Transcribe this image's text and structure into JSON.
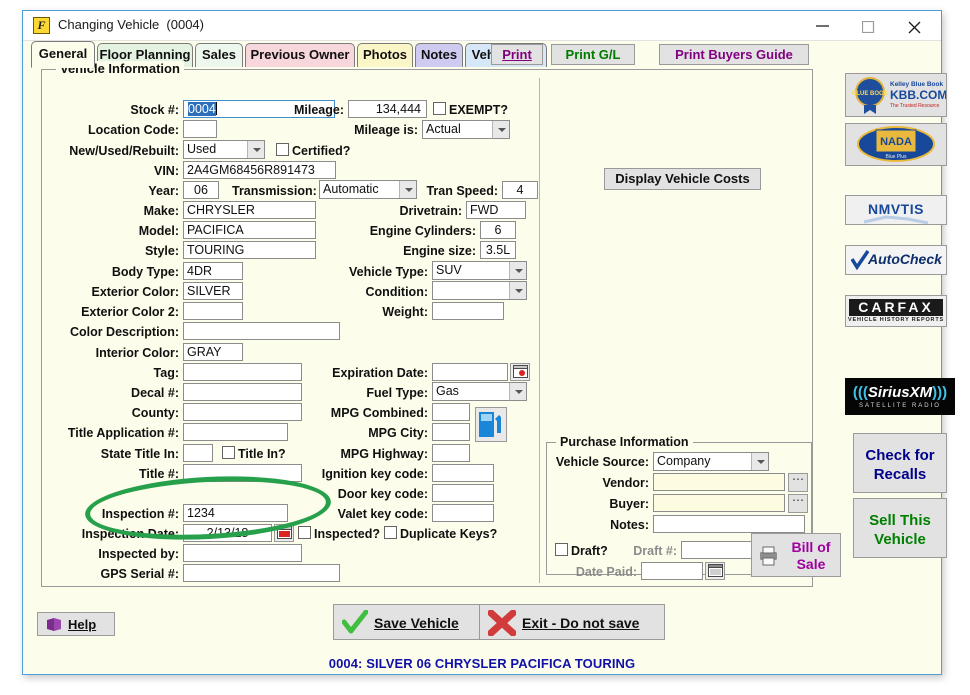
{
  "window": {
    "title": "Changing Vehicle  (0004)",
    "icon": "app-icon",
    "minimize": "minimize-icon",
    "maximize": "maximize-icon",
    "close": "close-icon"
  },
  "tabs": [
    {
      "label": "General",
      "active": true,
      "color": "#fdfdec"
    },
    {
      "label": "Floor Planning",
      "active": false,
      "color": "#e4f2e2"
    },
    {
      "label": "Sales",
      "active": false,
      "color": "#eef7ee"
    },
    {
      "label": "Previous Owner",
      "active": false,
      "color": "#f8d7dc"
    },
    {
      "label": "Photos",
      "active": false,
      "color": "#fbf6c8"
    },
    {
      "label": "Notes",
      "active": false,
      "color": "#cfcbf0"
    },
    {
      "label": "Vehicle Bill",
      "active": false,
      "color": "#d6e7f7"
    }
  ],
  "toolbar": {
    "print": "Print",
    "print_gl": "Print G/L",
    "print_buyers_guide": "Print Buyers Guide",
    "print_gl_color": "#007a00",
    "buyers_guide_color": "#800080",
    "print_color": "#800080"
  },
  "panel": {
    "legend": "Vehicle Information"
  },
  "fields": {
    "stock_no": {
      "label": "Stock #:",
      "value": "0004"
    },
    "mileage": {
      "label": "Mileage:",
      "value": "134,444"
    },
    "exempt": {
      "label": "EXEMPT?",
      "checked": false
    },
    "location_code": {
      "label": "Location Code:",
      "value": ""
    },
    "mileage_is": {
      "label": "Mileage is:",
      "value": "Actual"
    },
    "new_used": {
      "label": "New/Used/Rebuilt:",
      "value": "Used"
    },
    "certified": {
      "label": "Certified?",
      "checked": false
    },
    "vin": {
      "label": "VIN:",
      "value": "2A4GM68456R891473"
    },
    "year": {
      "label": "Year:",
      "value": "06"
    },
    "transmission": {
      "label": "Transmission:",
      "value": "Automatic"
    },
    "tran_speed": {
      "label": "Tran Speed:",
      "value": "4"
    },
    "make": {
      "label": "Make:",
      "value": "CHRYSLER"
    },
    "drivetrain": {
      "label": "Drivetrain:",
      "value": "FWD"
    },
    "model": {
      "label": "Model:",
      "value": "PACIFICA"
    },
    "engine_cylinders": {
      "label": "Engine Cylinders:",
      "value": "6"
    },
    "style": {
      "label": "Style:",
      "value": "TOURING"
    },
    "engine_size": {
      "label": "Engine size:",
      "value": "3.5L"
    },
    "body_type": {
      "label": "Body Type:",
      "value": "4DR"
    },
    "vehicle_type": {
      "label": "Vehicle Type:",
      "value": "SUV"
    },
    "exterior_color": {
      "label": "Exterior Color:",
      "value": "SILVER"
    },
    "condition": {
      "label": "Condition:",
      "value": ""
    },
    "exterior_color2": {
      "label": "Exterior Color 2:",
      "value": ""
    },
    "weight": {
      "label": "Weight:",
      "value": ""
    },
    "color_desc": {
      "label": "Color Description:",
      "value": ""
    },
    "interior_color": {
      "label": "Interior Color:",
      "value": "GRAY"
    },
    "tag": {
      "label": "Tag:",
      "value": ""
    },
    "expiration_date": {
      "label": "Expiration Date:",
      "value": ""
    },
    "decal_no": {
      "label": "Decal #:",
      "value": ""
    },
    "fuel_type": {
      "label": "Fuel Type:",
      "value": "Gas"
    },
    "county": {
      "label": "County:",
      "value": ""
    },
    "mpg_combined": {
      "label": "MPG Combined:",
      "value": ""
    },
    "title_app_no": {
      "label": "Title Application #:",
      "value": ""
    },
    "mpg_city": {
      "label": "MPG City:",
      "value": ""
    },
    "state_title_in": {
      "label": "State Title In:",
      "value": ""
    },
    "title_in": {
      "label": "Title In?",
      "checked": false
    },
    "mpg_highway": {
      "label": "MPG Highway:",
      "value": ""
    },
    "title_no": {
      "label": "Title #:",
      "value": ""
    },
    "ignition_key": {
      "label": "Ignition key code:",
      "value": ""
    },
    "door_key": {
      "label": "Door key code:",
      "value": ""
    },
    "inspection_no": {
      "label": "Inspection #:",
      "value": "1234"
    },
    "valet_key": {
      "label": "Valet key code:",
      "value": ""
    },
    "inspection_date": {
      "label": "Inspection Date:",
      "value": "2/13/18"
    },
    "inspected": {
      "label": "Inspected?",
      "checked": false
    },
    "duplicate_keys": {
      "label": "Duplicate Keys?",
      "checked": false
    },
    "inspected_by": {
      "label": "Inspected by:",
      "value": ""
    },
    "gps_serial": {
      "label": "GPS Serial #:",
      "value": ""
    }
  },
  "display_costs_button": "Display Vehicle Costs",
  "purchase": {
    "legend": "Purchase Information",
    "vehicle_source": {
      "label": "Vehicle Source:",
      "value": "Company"
    },
    "vendor": {
      "label": "Vendor:",
      "value": ""
    },
    "buyer": {
      "label": "Buyer:",
      "value": ""
    },
    "notes": {
      "label": "Notes:",
      "value": ""
    },
    "draft": {
      "label": "Draft?",
      "checked": false
    },
    "draft_no": {
      "label": "Draft #:",
      "value": ""
    },
    "date_paid": {
      "label": "Date Paid:",
      "value": ""
    },
    "bill_of_sale": {
      "line1": "Bill of",
      "line2": "Sale",
      "color": "#a000a0"
    }
  },
  "rail": [
    {
      "name": "kbb",
      "type": "logo",
      "line1": "Kelley Blue Book",
      "line2": "KBB.COM",
      "line3": "The Trusted Resource"
    },
    {
      "name": "nada",
      "type": "logo",
      "line1": "NADA",
      "line2": "Blue Plus"
    },
    {
      "name": "nmvtis",
      "type": "logo",
      "line1": "NMVTIS"
    },
    {
      "name": "autocheck",
      "type": "logo",
      "line1": "AutoCheck"
    },
    {
      "name": "carfax",
      "type": "logo",
      "line1": "CARFAX",
      "line2": "VEHICLE HISTORY REPORTS"
    },
    {
      "name": "siriusxm",
      "type": "logo",
      "line1": "SiriusXM",
      "line2": "SATELLITE RADIO"
    },
    {
      "name": "check-recalls",
      "type": "text",
      "line1": "Check for",
      "line2": "Recalls",
      "color": "#00008b"
    },
    {
      "name": "sell-vehicle",
      "type": "text",
      "line1": "Sell This",
      "line2": "Vehicle",
      "color": "#008000"
    }
  ],
  "footer": {
    "help": "Help",
    "save": "Save Vehicle",
    "exit": "Exit - Do not save",
    "status": "0004: SILVER 06 CHRYSLER PACIFICA TOURING"
  },
  "annotation": {
    "shape": "ellipse",
    "color": "#27a04b",
    "target": "inspection-number-field"
  }
}
